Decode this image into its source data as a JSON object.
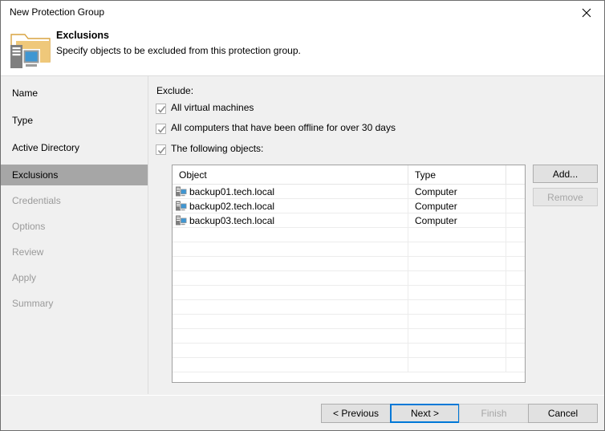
{
  "window": {
    "title": "New Protection Group",
    "close_icon": "close-icon"
  },
  "header": {
    "icon": "protection-group-folder-icon",
    "title": "Exclusions",
    "subtitle": "Specify objects to be excluded from this protection group."
  },
  "sidebar": {
    "items": [
      {
        "label": "Name",
        "state": "visited"
      },
      {
        "label": "Type",
        "state": "visited"
      },
      {
        "label": "Active Directory",
        "state": "visited"
      },
      {
        "label": "Exclusions",
        "state": "selected"
      },
      {
        "label": "Credentials",
        "state": "disabled"
      },
      {
        "label": "Options",
        "state": "disabled"
      },
      {
        "label": "Review",
        "state": "disabled"
      },
      {
        "label": "Apply",
        "state": "disabled"
      },
      {
        "label": "Summary",
        "state": "disabled"
      }
    ]
  },
  "main": {
    "exclude_label": "Exclude:",
    "checkboxes": [
      {
        "label": "All virtual machines",
        "checked": true
      },
      {
        "label": "All computers that have been offline for over 30 days",
        "checked": true
      },
      {
        "label": "The following objects:",
        "checked": true
      }
    ],
    "grid": {
      "columns": [
        "Object",
        "Type",
        ""
      ],
      "rows": [
        {
          "object": "backup01.tech.local",
          "type": "Computer",
          "icon": "computer-icon"
        },
        {
          "object": "backup02.tech.local",
          "type": "Computer",
          "icon": "computer-icon"
        },
        {
          "object": "backup03.tech.local",
          "type": "Computer",
          "icon": "computer-icon"
        }
      ],
      "empty_row_count": 10
    },
    "side_buttons": [
      {
        "label": "Add...",
        "enabled": true
      },
      {
        "label": "Remove",
        "enabled": false
      }
    ]
  },
  "footer": {
    "buttons": [
      {
        "label": "< Previous",
        "enabled": true,
        "focused": false
      },
      {
        "label": "Next >",
        "enabled": true,
        "focused": true
      },
      {
        "label": "Finish",
        "enabled": false,
        "focused": false
      },
      {
        "label": "Cancel",
        "enabled": true,
        "focused": false
      }
    ]
  },
  "colors": {
    "accent": "#0078d7",
    "selected_nav": "#a6a6a6",
    "folder": "#efc87a",
    "monitor": "#3f96d2",
    "tower": "#7f7f7f",
    "dialog_bg": "#f0f0f0"
  }
}
